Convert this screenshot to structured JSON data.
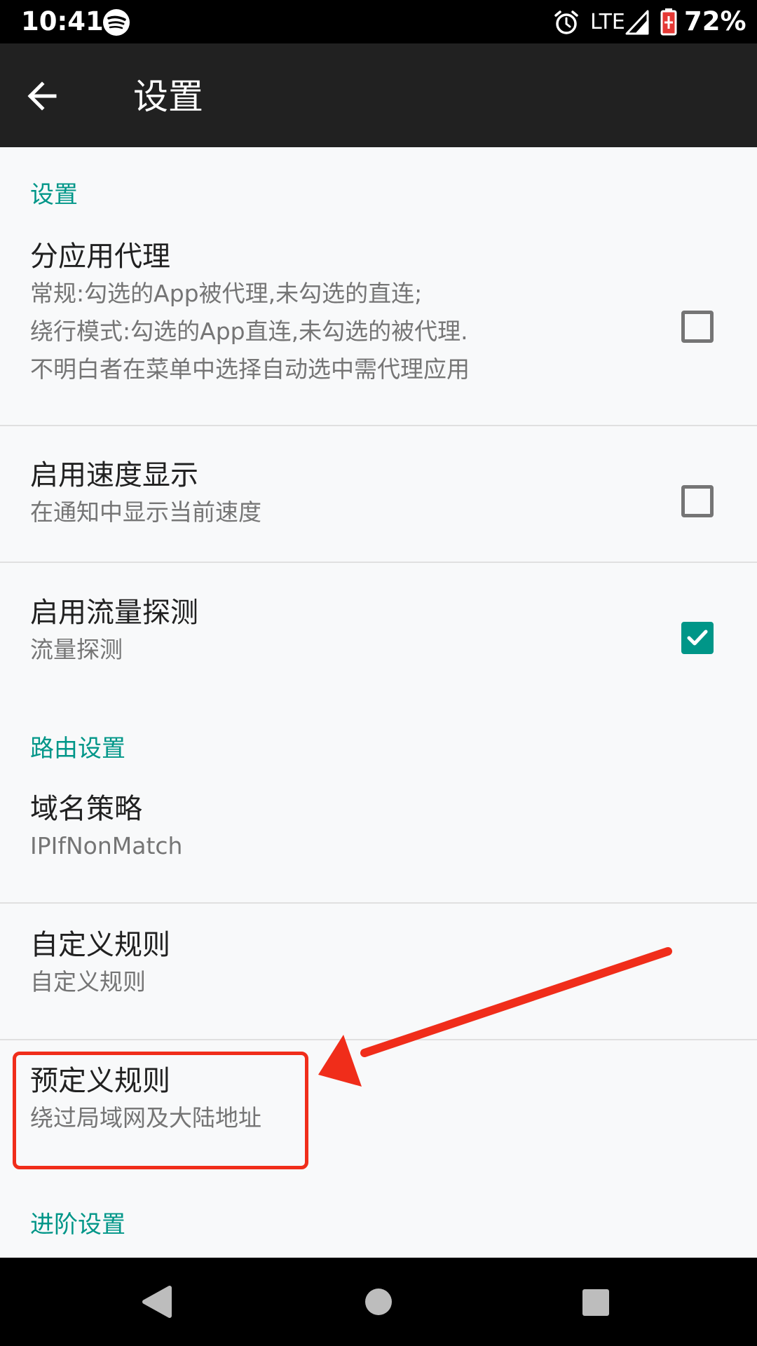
{
  "status_bar": {
    "time": "10:41",
    "network": "LTE",
    "battery": "72%",
    "icons": [
      "spotify-icon",
      "alarm-icon",
      "signal-icon",
      "battery-icon"
    ]
  },
  "toolbar": {
    "title": "设置",
    "back_icon": "arrow-back-icon"
  },
  "sections": {
    "settings": {
      "header": "设置",
      "per_app_proxy": {
        "title": "分应用代理",
        "summary": "常规:勾选的App被代理,未勾选的直连;\n绕行模式:勾选的App直连,未勾选的被代理.\n不明白者在菜单中选择自动选中需代理应用",
        "checked": false
      },
      "speed_display": {
        "title": "启用速度显示",
        "summary": "在通知中显示当前速度",
        "checked": false
      },
      "traffic_sniffing": {
        "title": "启用流量探测",
        "summary": "流量探测",
        "checked": true
      }
    },
    "routing": {
      "header": "路由设置",
      "domain_strategy": {
        "title": "域名策略",
        "summary": "IPIfNonMatch"
      },
      "custom_rules": {
        "title": "自定义规则",
        "summary": "自定义规则"
      },
      "predefined_rules": {
        "title": "预定义规则",
        "summary": "绕过局域网及大陆地址"
      }
    },
    "advanced": {
      "header": "进阶设置"
    }
  },
  "colors": {
    "accent": "#009688",
    "toolbar": "#212121",
    "annotation": "#f02d1a"
  },
  "nav_bar": {
    "icons": [
      "back-triangle-icon",
      "home-circle-icon",
      "recents-square-icon"
    ]
  }
}
